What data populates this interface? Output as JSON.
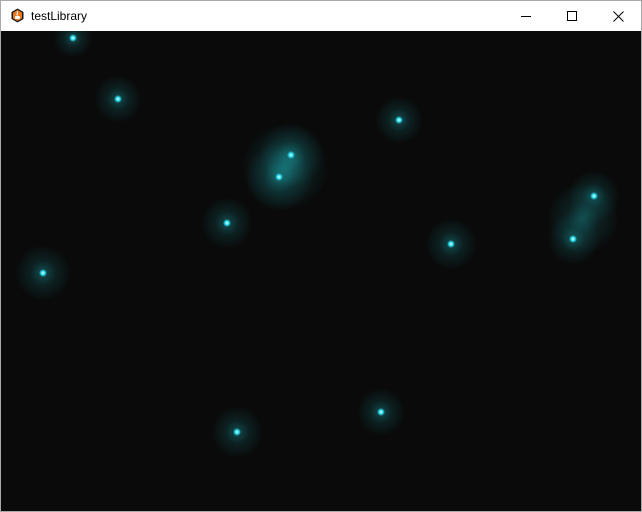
{
  "window": {
    "title": "testLibrary",
    "icons": {
      "app": "java-cup-icon",
      "minimize": "minimize-icon",
      "maximize": "maximize-icon",
      "close": "close-icon"
    }
  },
  "canvas": {
    "background": "#0a0a0a",
    "particle_color": "#2ee6ff",
    "glow_color": "#20c8d0",
    "particle_count": 13,
    "icon": "glowing-particle-icon"
  }
}
